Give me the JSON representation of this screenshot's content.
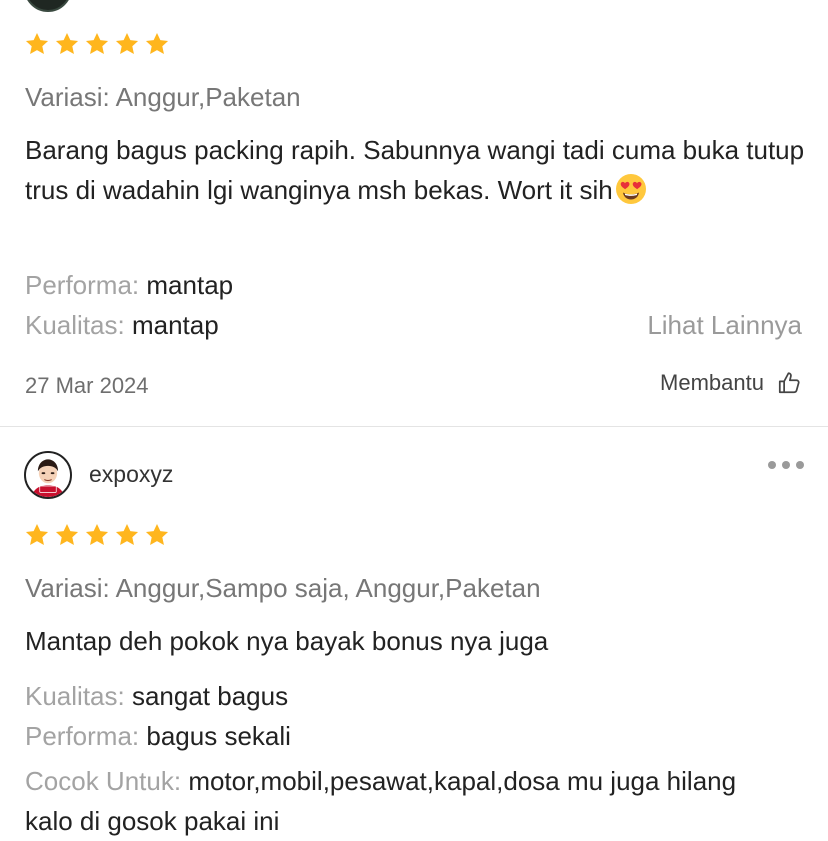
{
  "reviews": [
    {
      "rating": 5,
      "variant_label": "Variasi:",
      "variant_value": "Anggur,Paketan",
      "text": "Barang bagus packing rapih. Sabunnya wangi tadi cuma buka tutup trus di wadahin lgi wanginya msh bekas. Wort it sih",
      "attributes": [
        {
          "label": "Performa:",
          "value": "mantap"
        },
        {
          "label": "Kualitas:",
          "value": "mantap"
        }
      ],
      "see_more": "Lihat Lainnya",
      "date": "27 Mar 2024",
      "helpful_label": "Membantu"
    },
    {
      "username": "expoxyz",
      "rating": 5,
      "variant_label": "Variasi:",
      "variant_value": "Anggur,Sampo saja, Anggur,Paketan",
      "text": "Mantap deh pokok nya bayak bonus nya juga",
      "attributes": [
        {
          "label": "Kualitas:",
          "value": "sangat bagus"
        },
        {
          "label": "Performa:",
          "value": "bagus sekali"
        },
        {
          "label": "Cocok Untuk:",
          "value": "motor,mobil,pesawat,kapal,dosa mu juga hilang kalo di gosok pakai ini"
        }
      ]
    }
  ],
  "icons": {
    "star": "star-icon",
    "thumbs_up": "thumbs-up-icon",
    "more": "more-dots-icon",
    "emoji": "heart-eyes-emoji"
  },
  "colors": {
    "star": "#FFB61E",
    "label_gray": "#A3A3A3",
    "text": "#222222"
  }
}
